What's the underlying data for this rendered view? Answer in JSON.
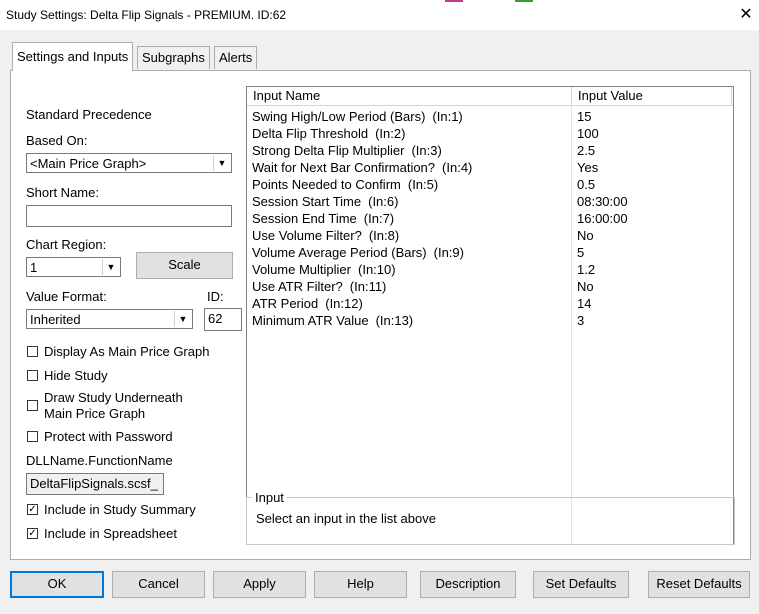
{
  "window": {
    "title": "Study Settings: Delta Flip Signals - PREMIUM. ID:62"
  },
  "tabs": [
    "Settings and Inputs",
    "Subgraphs",
    "Alerts"
  ],
  "left": {
    "standard_precedence": "Standard Precedence",
    "based_on_label": "Based On:",
    "based_on_value": "<Main Price Graph>",
    "short_name_label": "Short Name:",
    "short_name_value": "",
    "chart_region_label": "Chart Region:",
    "chart_region_value": "1",
    "scale_button": "Scale",
    "value_format_label": "Value Format:",
    "value_format_value": "Inherited",
    "id_label": "ID:",
    "id_value": "62",
    "checkboxes": [
      {
        "label": "Display As Main Price Graph",
        "checked": false
      },
      {
        "label": "Hide Study",
        "checked": false
      },
      {
        "label": "Draw Study Underneath",
        "label2": "Main Price Graph",
        "checked": false
      },
      {
        "label": "Protect with Password",
        "checked": false
      }
    ],
    "dll_label": "DLLName.FunctionName",
    "dll_value": "DeltaFlipSignals.scsf_",
    "include_summary": {
      "label": "Include in Study Summary",
      "checked": true
    },
    "include_spreadsheet": {
      "label": "Include in Spreadsheet",
      "checked": true
    }
  },
  "inputs_list": {
    "columns": [
      "Input Name",
      "Input Value"
    ],
    "rows": [
      {
        "name": "Swing High/Low Period (Bars)",
        "tag": "(In:1)",
        "value": "15"
      },
      {
        "name": "Delta Flip Threshold",
        "tag": "(In:2)",
        "value": "100"
      },
      {
        "name": "Strong Delta Flip Multiplier",
        "tag": "(In:3)",
        "value": "2.5"
      },
      {
        "name": "Wait for Next Bar Confirmation?",
        "tag": "(In:4)",
        "value": "Yes"
      },
      {
        "name": "Points Needed to Confirm",
        "tag": "(In:5)",
        "value": "0.5"
      },
      {
        "name": "Session Start Time",
        "tag": "(In:6)",
        "value": "08:30:00"
      },
      {
        "name": "Session End Time",
        "tag": "(In:7)",
        "value": "16:00:00"
      },
      {
        "name": "Use Volume Filter?",
        "tag": "(In:8)",
        "value": "No"
      },
      {
        "name": "Volume Average Period (Bars)",
        "tag": "(In:9)",
        "value": "5"
      },
      {
        "name": "Volume Multiplier",
        "tag": "(In:10)",
        "value": "1.2"
      },
      {
        "name": "Use ATR Filter?",
        "tag": "(In:11)",
        "value": "No"
      },
      {
        "name": "ATR Period",
        "tag": "(In:12)",
        "value": "14"
      },
      {
        "name": "Minimum ATR Value",
        "tag": "(In:13)",
        "value": "3"
      }
    ]
  },
  "input_group": {
    "label": "Input",
    "hint": "Select an input in the list above"
  },
  "buttons": {
    "ok": "OK",
    "cancel": "Cancel",
    "apply": "Apply",
    "help": "Help",
    "description": "Description",
    "set_defaults": "Set Defaults",
    "reset_defaults": "Reset Defaults"
  },
  "colors": {
    "focus_blue": "#0078d7",
    "button_face": "#e1e1e1",
    "border": "#adadad"
  }
}
